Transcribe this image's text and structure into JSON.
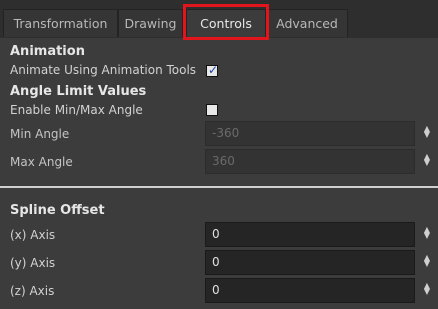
{
  "tabs": [
    "Transformation",
    "Drawing",
    "Controls",
    "Advanced"
  ],
  "animation": {
    "title": "Animation",
    "animate_label": "Animate Using Animation Tools",
    "animate_checked": true
  },
  "angle_limits": {
    "title": "Angle Limit Values",
    "enable_label": "Enable Min/Max Angle",
    "enable_checked": false,
    "min_label": "Min Angle",
    "min_value": "-360",
    "max_label": "Max Angle",
    "max_value": "360"
  },
  "spline_offset": {
    "title": "Spline Offset",
    "x_label": "(x) Axis",
    "x_value": "0",
    "y_label": "(y) Axis",
    "y_value": "0",
    "z_label": "(z) Axis",
    "z_value": "0"
  },
  "icons": {
    "check": "✓",
    "spin_up": "▲",
    "spin_down": "▼"
  }
}
